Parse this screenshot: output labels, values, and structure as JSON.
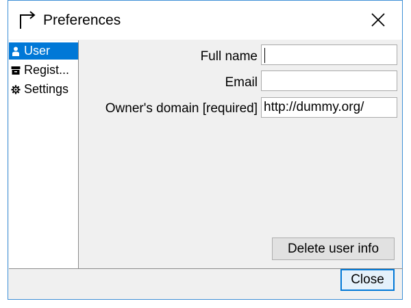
{
  "window": {
    "title": "Preferences",
    "title_icon": "arrow-turn-up-right-icon",
    "close_icon": "close-icon"
  },
  "sidebar": {
    "items": [
      {
        "label": "User",
        "icon": "person-icon",
        "selected": true
      },
      {
        "label": "Regist...",
        "icon": "archive-box-icon",
        "selected": false
      },
      {
        "label": "Settings",
        "icon": "gear-icon",
        "selected": false
      }
    ]
  },
  "form": {
    "full_name": {
      "label": "Full name",
      "value": ""
    },
    "email": {
      "label": "Email",
      "value": ""
    },
    "domain": {
      "label": "Owner's domain [required]",
      "value": "http://dummy.org/"
    }
  },
  "buttons": {
    "delete_label": "Delete user info",
    "close_label": "Close"
  },
  "colors": {
    "accent": "#0078d7",
    "window_border": "#3c8fd6",
    "panel_bg": "#f0f0f0"
  }
}
